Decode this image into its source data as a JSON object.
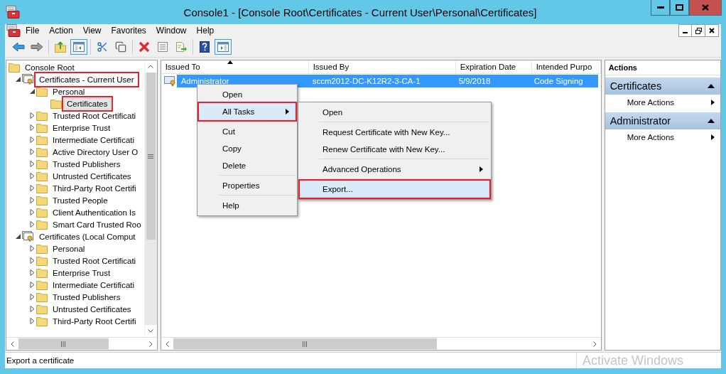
{
  "window": {
    "title": "Console1 - [Console Root\\Certificates - Current User\\Personal\\Certificates]"
  },
  "menu_bar": [
    "File",
    "Action",
    "View",
    "Favorites",
    "Window",
    "Help"
  ],
  "toolbar": [
    [
      {
        "kind": "back",
        "pressed": false
      },
      {
        "kind": "forward",
        "pressed": false
      }
    ],
    [
      {
        "kind": "up",
        "pressed": false
      },
      {
        "kind": "tree",
        "pressed": true
      }
    ],
    [
      {
        "kind": "cut",
        "pressed": false
      },
      {
        "kind": "copy",
        "pressed": false
      }
    ],
    [
      {
        "kind": "delete",
        "pressed": false
      },
      {
        "kind": "properties",
        "pressed": false
      },
      {
        "kind": "export",
        "pressed": false
      }
    ],
    [
      {
        "kind": "help",
        "pressed": false
      },
      {
        "kind": "actionpane",
        "pressed": true
      }
    ]
  ],
  "tree": [
    {
      "label": "Console Root",
      "kind": "folder",
      "selected": false,
      "highlighted": false,
      "children": [
        {
          "label": "Certificates - Current User",
          "kind": "store",
          "expanded": true,
          "selected": false,
          "highlighted": true,
          "children": [
            {
              "label": "Personal",
              "kind": "folder",
              "expanded": true,
              "selected": false,
              "highlighted": false,
              "children": [
                {
                  "label": "Certificates",
                  "kind": "folder",
                  "selected": true,
                  "highlighted": true
                }
              ]
            },
            {
              "label": "Trusted Root Certificati",
              "kind": "folder",
              "expanded": false,
              "selected": false,
              "highlighted": false
            },
            {
              "label": "Enterprise Trust",
              "kind": "folder",
              "expanded": false,
              "selected": false,
              "highlighted": false
            },
            {
              "label": "Intermediate Certificati",
              "kind": "folder",
              "expanded": false,
              "selected": false,
              "highlighted": false
            },
            {
              "label": "Active Directory User O",
              "kind": "folder",
              "expanded": false,
              "selected": false,
              "highlighted": false
            },
            {
              "label": "Trusted Publishers",
              "kind": "folder",
              "expanded": false,
              "selected": false,
              "highlighted": false
            },
            {
              "label": "Untrusted Certificates",
              "kind": "folder",
              "expanded": false,
              "selected": false,
              "highlighted": false
            },
            {
              "label": "Third-Party Root Certifi",
              "kind": "folder",
              "expanded": false,
              "selected": false,
              "highlighted": false
            },
            {
              "label": "Trusted People",
              "kind": "folder",
              "expanded": false,
              "selected": false,
              "highlighted": false
            },
            {
              "label": "Client Authentication Is",
              "kind": "folder",
              "expanded": false,
              "selected": false,
              "highlighted": false
            },
            {
              "label": "Smart Card Trusted Roo",
              "kind": "folder",
              "expanded": false,
              "selected": false,
              "highlighted": false
            }
          ]
        },
        {
          "label": "Certificates (Local Comput",
          "kind": "store",
          "expanded": true,
          "selected": false,
          "highlighted": false,
          "children": [
            {
              "label": "Personal",
              "kind": "folder",
              "expanded": false,
              "selected": false,
              "highlighted": false
            },
            {
              "label": "Trusted Root Certificati",
              "kind": "folder",
              "expanded": false,
              "selected": false,
              "highlighted": false
            },
            {
              "label": "Enterprise Trust",
              "kind": "folder",
              "expanded": false,
              "selected": false,
              "highlighted": false
            },
            {
              "label": "Intermediate Certificati",
              "kind": "folder",
              "expanded": false,
              "selected": false,
              "highlighted": false
            },
            {
              "label": "Trusted Publishers",
              "kind": "folder",
              "expanded": false,
              "selected": false,
              "highlighted": false
            },
            {
              "label": "Untrusted Certificates",
              "kind": "folder",
              "expanded": false,
              "selected": false,
              "highlighted": false
            },
            {
              "label": "Third-Party Root Certifi",
              "kind": "folder",
              "expanded": false,
              "selected": false,
              "highlighted": false
            }
          ]
        }
      ]
    }
  ],
  "table": {
    "columns": [
      {
        "label": "Issued To",
        "sorted": true
      },
      {
        "label": "Issued By",
        "sorted": false
      },
      {
        "label": "Expiration Date",
        "sorted": false
      },
      {
        "label": "Intended Purpo",
        "sorted": false
      }
    ],
    "rows": [
      {
        "cells": [
          "Administrator",
          "sccm2012-DC-K12R2-3-CA-1",
          "5/9/2018",
          "Code Signing"
        ],
        "selected": true
      }
    ]
  },
  "context_menu": {
    "items": [
      {
        "kind": "item",
        "label": "Open",
        "selected": false,
        "highlighted": false,
        "submenu": false
      },
      {
        "kind": "item",
        "label": "All Tasks",
        "selected": true,
        "highlighted": true,
        "submenu": true
      },
      {
        "kind": "separator"
      },
      {
        "kind": "item",
        "label": "Cut",
        "selected": false,
        "highlighted": false,
        "submenu": false
      },
      {
        "kind": "item",
        "label": "Copy",
        "selected": false,
        "highlighted": false,
        "submenu": false
      },
      {
        "kind": "item",
        "label": "Delete",
        "selected": false,
        "highlighted": false,
        "submenu": false
      },
      {
        "kind": "separator"
      },
      {
        "kind": "item",
        "label": "Properties",
        "selected": false,
        "highlighted": false,
        "submenu": false
      },
      {
        "kind": "separator"
      },
      {
        "kind": "item",
        "label": "Help",
        "selected": false,
        "highlighted": false,
        "submenu": false
      }
    ],
    "submenu": {
      "items": [
        {
          "kind": "item",
          "label": "Open",
          "selected": false,
          "highlighted": false,
          "submenu": false
        },
        {
          "kind": "separator"
        },
        {
          "kind": "item",
          "label": "Request Certificate with New Key...",
          "selected": false,
          "highlighted": false,
          "submenu": false
        },
        {
          "kind": "item",
          "label": "Renew Certificate with New Key...",
          "selected": false,
          "highlighted": false,
          "submenu": false
        },
        {
          "kind": "separator"
        },
        {
          "kind": "item",
          "label": "Advanced Operations",
          "selected": false,
          "highlighted": false,
          "submenu": true
        },
        {
          "kind": "separator"
        },
        {
          "kind": "item",
          "label": "Export...",
          "selected": true,
          "highlighted": true,
          "submenu": false
        }
      ]
    }
  },
  "actions": {
    "title": "Actions",
    "groups": [
      {
        "title": "Certificates",
        "expanded": true,
        "items": [
          "More Actions"
        ]
      },
      {
        "title": "Administrator",
        "expanded": true,
        "items": [
          "More Actions"
        ]
      }
    ]
  },
  "status_bar": {
    "text": "Export a certificate",
    "notice": "Activate Windows"
  }
}
